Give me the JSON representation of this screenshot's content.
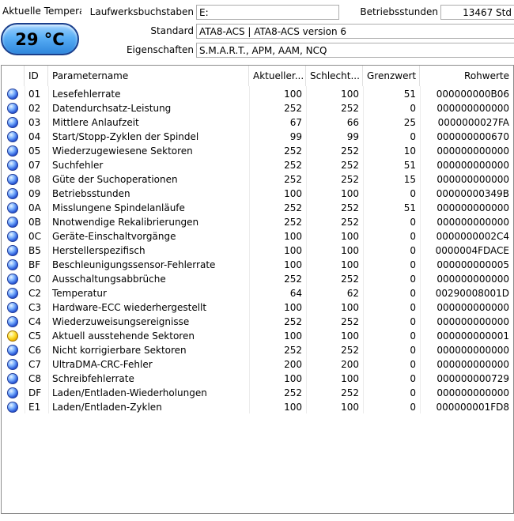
{
  "top": {
    "temp_label": "Aktuelle Temperat",
    "temp_value": "29 °C",
    "drive_letter_label": "Laufwerksbuchstaben",
    "drive_letter_value": "E:",
    "hours_label": "Betriebsstunden",
    "hours_value": "13467 Std",
    "standard_label": "Standard",
    "standard_value": "ATA8-ACS | ATA8-ACS version 6",
    "features_label": "Eigenschaften",
    "features_value": "S.M.A.R.T., APM, AAM, NCQ"
  },
  "table": {
    "headers": {
      "id": "ID",
      "name": "Parametername",
      "current": "Aktueller...",
      "worst": "Schlecht...",
      "threshold": "Grenzwert",
      "raw": "Rohwerte"
    },
    "rows": [
      {
        "status": "blue",
        "id": "01",
        "name": "Lesefehlerrate",
        "current": "100",
        "worst": "100",
        "threshold": "51",
        "raw": "000000000B06"
      },
      {
        "status": "blue",
        "id": "02",
        "name": "Datendurchsatz-Leistung",
        "current": "252",
        "worst": "252",
        "threshold": "0",
        "raw": "000000000000"
      },
      {
        "status": "blue",
        "id": "03",
        "name": "Mittlere Anlaufzeit",
        "current": "67",
        "worst": "66",
        "threshold": "25",
        "raw": "0000000027FA"
      },
      {
        "status": "blue",
        "id": "04",
        "name": "Start/Stopp-Zyklen der Spindel",
        "current": "99",
        "worst": "99",
        "threshold": "0",
        "raw": "000000000670"
      },
      {
        "status": "blue",
        "id": "05",
        "name": "Wiederzugewiesene Sektoren",
        "current": "252",
        "worst": "252",
        "threshold": "10",
        "raw": "000000000000"
      },
      {
        "status": "blue",
        "id": "07",
        "name": "Suchfehler",
        "current": "252",
        "worst": "252",
        "threshold": "51",
        "raw": "000000000000"
      },
      {
        "status": "blue",
        "id": "08",
        "name": "Güte der Suchoperationen",
        "current": "252",
        "worst": "252",
        "threshold": "15",
        "raw": "000000000000"
      },
      {
        "status": "blue",
        "id": "09",
        "name": "Betriebsstunden",
        "current": "100",
        "worst": "100",
        "threshold": "0",
        "raw": "00000000349B"
      },
      {
        "status": "blue",
        "id": "0A",
        "name": "Misslungene Spindelanläufe",
        "current": "252",
        "worst": "252",
        "threshold": "51",
        "raw": "000000000000"
      },
      {
        "status": "blue",
        "id": "0B",
        "name": "Nnotwendige Rekalibrierungen",
        "current": "252",
        "worst": "252",
        "threshold": "0",
        "raw": "000000000000"
      },
      {
        "status": "blue",
        "id": "0C",
        "name": "Geräte-Einschaltvorgänge",
        "current": "100",
        "worst": "100",
        "threshold": "0",
        "raw": "0000000002C4"
      },
      {
        "status": "blue",
        "id": "B5",
        "name": "Herstellerspezifisch",
        "current": "100",
        "worst": "100",
        "threshold": "0",
        "raw": "0000004FDACE"
      },
      {
        "status": "blue",
        "id": "BF",
        "name": "Beschleunigungssensor-Fehlerrate",
        "current": "100",
        "worst": "100",
        "threshold": "0",
        "raw": "000000000005"
      },
      {
        "status": "blue",
        "id": "C0",
        "name": "Ausschaltungsabbrüche",
        "current": "252",
        "worst": "252",
        "threshold": "0",
        "raw": "000000000000"
      },
      {
        "status": "blue",
        "id": "C2",
        "name": "Temperatur",
        "current": "64",
        "worst": "62",
        "threshold": "0",
        "raw": "00290008001D"
      },
      {
        "status": "blue",
        "id": "C3",
        "name": "Hardware-ECC wiederhergestellt",
        "current": "100",
        "worst": "100",
        "threshold": "0",
        "raw": "000000000000"
      },
      {
        "status": "blue",
        "id": "C4",
        "name": "Wiederzuweisungsereignisse",
        "current": "252",
        "worst": "252",
        "threshold": "0",
        "raw": "000000000000"
      },
      {
        "status": "yellow",
        "id": "C5",
        "name": "Aktuell ausstehende Sektoren",
        "current": "100",
        "worst": "100",
        "threshold": "0",
        "raw": "000000000001"
      },
      {
        "status": "blue",
        "id": "C6",
        "name": "Nicht korrigierbare Sektoren",
        "current": "252",
        "worst": "252",
        "threshold": "0",
        "raw": "000000000000"
      },
      {
        "status": "blue",
        "id": "C7",
        "name": "UltraDMA-CRC-Fehler",
        "current": "200",
        "worst": "200",
        "threshold": "0",
        "raw": "000000000000"
      },
      {
        "status": "blue",
        "id": "C8",
        "name": "Schreibfehlerrate",
        "current": "100",
        "worst": "100",
        "threshold": "0",
        "raw": "000000000729"
      },
      {
        "status": "blue",
        "id": "DF",
        "name": "Laden/Entladen-Wiederholungen",
        "current": "252",
        "worst": "252",
        "threshold": "0",
        "raw": "000000000000"
      },
      {
        "status": "blue",
        "id": "E1",
        "name": "Laden/Entladen-Zyklen",
        "current": "100",
        "worst": "100",
        "threshold": "0",
        "raw": "000000001FD8"
      }
    ]
  }
}
